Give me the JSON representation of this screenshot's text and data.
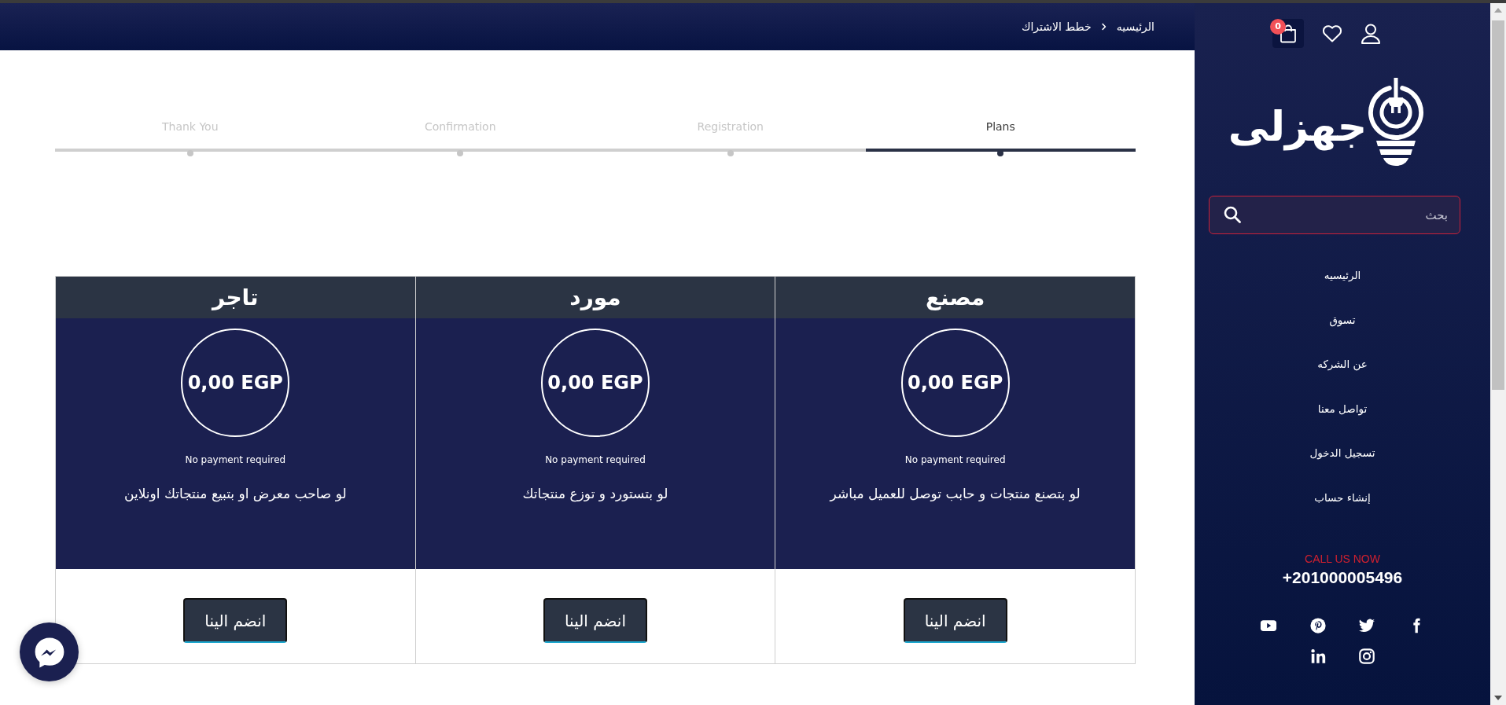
{
  "header": {
    "breadcrumb": [
      "الرئيسيه",
      "خطط الاشتراك"
    ]
  },
  "steps": [
    {
      "label": "Plans",
      "selected": true
    },
    {
      "label": "Registration",
      "selected": false
    },
    {
      "label": "Confirmation",
      "selected": false
    },
    {
      "label": "Thank You",
      "selected": false
    }
  ],
  "plans": [
    {
      "title": "مصنع",
      "price": "0,00 EGP",
      "note": "No payment required",
      "description": "لو بتصنع منتجات و حابب توصل للعميل مباشر",
      "button": "انضم الينا"
    },
    {
      "title": "مورد",
      "price": "0,00 EGP",
      "note": "No payment required",
      "description": "لو بتستورد و توزع منتجاتك",
      "button": "انضم الينا"
    },
    {
      "title": "تاجر",
      "price": "0,00 EGP",
      "note": "No payment required",
      "description": "لو صاحب معرض او بتبيع منتجاتك اونلاين",
      "button": "انضم الينا"
    }
  ],
  "sidebar": {
    "cart_count": "0",
    "logo": "جهزلى",
    "search": {
      "placeholder": "بحث"
    },
    "menu": [
      "الرئيسيه",
      "تسوق",
      "عن الشركه",
      "تواصل معنا",
      "تسجيل الدخول",
      "إنشاء حساب"
    ],
    "call_label": "CALL US NOW",
    "phone": "+201000005496"
  }
}
